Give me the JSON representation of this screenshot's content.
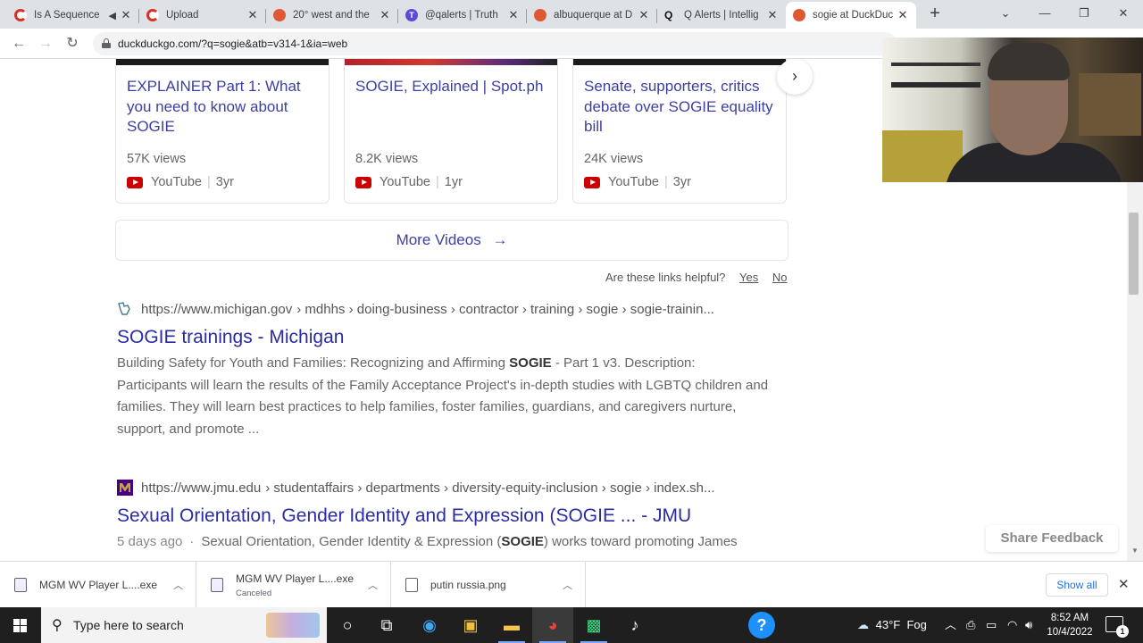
{
  "browser": {
    "tabs": [
      {
        "title": "Is A Sequence",
        "favicon": "c-icon",
        "muted": true
      },
      {
        "title": "Upload",
        "favicon": "c-icon"
      },
      {
        "title": "20° west and the",
        "favicon": "duckduckgo-icon"
      },
      {
        "title": "@qalerts | Truth",
        "favicon": "truth-icon"
      },
      {
        "title": "albuquerque at D",
        "favicon": "duckduckgo-icon"
      },
      {
        "title": "Q Alerts | Intellig",
        "favicon": "q-icon"
      },
      {
        "title": "sogie at DuckDuc",
        "favicon": "duckduckgo-icon",
        "active": true
      }
    ],
    "new_tab": "+",
    "url": "duckduckgo.com/?q=sogie&atb=v314-1&ia=web"
  },
  "videos": [
    {
      "title": "EXPLAINER Part 1: What you need to know about SOGIE",
      "views": "57K views",
      "source": "YouTube",
      "age": "3yr"
    },
    {
      "title": "SOGIE, Explained | Spot.ph",
      "views": "8.2K views",
      "source": "YouTube",
      "age": "1yr"
    },
    {
      "title": "Senate, supporters, critics debate over SOGIE equality bill",
      "views": "24K views",
      "source": "YouTube",
      "age": "3yr"
    }
  ],
  "more_videos": "More Videos",
  "helpful": {
    "question": "Are these links helpful?",
    "yes": "Yes",
    "no": "No"
  },
  "results": [
    {
      "url": "https://www.michigan.gov",
      "breadcrumb": "› mdhhs › doing-business › contractor › training › sogie › sogie-trainin...",
      "title": "SOGIE trainings - Michigan",
      "snippet_before": "Building Safety for Youth and Families: Recognizing and Affirming ",
      "snippet_bold": "SOGIE",
      "snippet_after": " - Part 1 v3. Description: Participants will learn the results of the Family Acceptance Project's in-depth studies with LGBTQ children and families. They will learn best practices to help families, foster families, guardians, and caregivers nurture, support, and promote ..."
    },
    {
      "url": "https://www.jmu.edu",
      "breadcrumb": "› studentaffairs › departments › diversity-equity-inclusion › sogie › index.sh...",
      "title": "Sexual Orientation, Gender Identity and Expression (SOGIE ... - JMU",
      "date": "5 days ago",
      "snippet_before": "Sexual Orientation, Gender Identity & Expression (",
      "snippet_bold": "SOGIE",
      "snippet_after": ") works toward promoting James"
    }
  ],
  "share_feedback": "Share Feedback",
  "downloads": [
    {
      "name": "MGM WV Player L....exe",
      "status": ""
    },
    {
      "name": "MGM WV Player L....exe",
      "status": "Canceled"
    },
    {
      "name": "putin russia.png",
      "status": ""
    }
  ],
  "show_all": "Show all",
  "taskbar": {
    "search_placeholder": "Type here to search",
    "weather": "43°F  Fog",
    "time": "8:52 AM",
    "date": "10/4/2022",
    "notifications": "1"
  },
  "colors": {
    "link": "#2b2ba4",
    "video_title": "#3c3fa1",
    "youtube": "#cc0000",
    "ddg": "#de5833"
  }
}
